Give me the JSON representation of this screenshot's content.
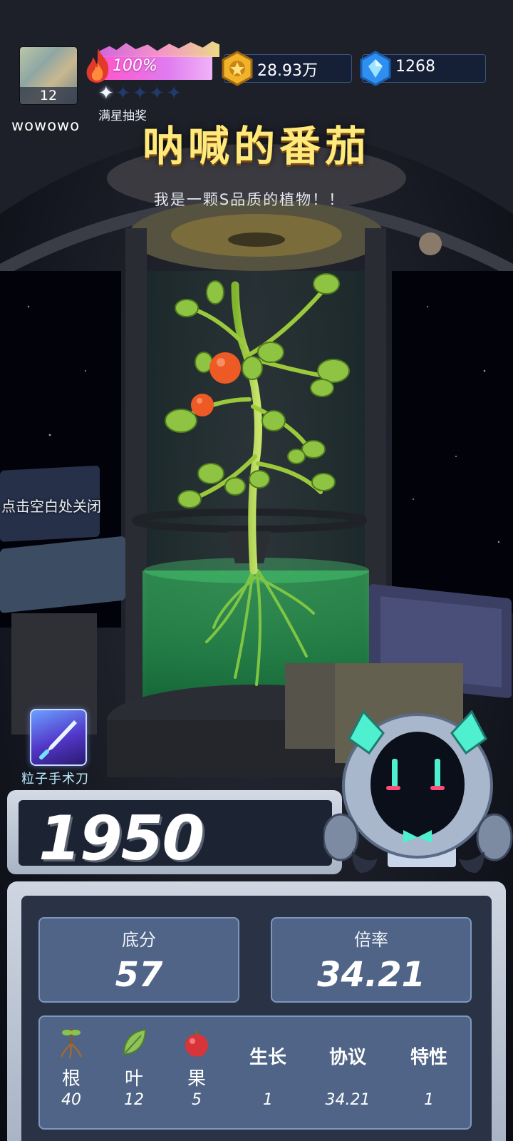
{
  "player": {
    "name": "wowowo",
    "level": "12"
  },
  "energy": {
    "percent_label": "100%"
  },
  "stars": {
    "label": "满星抽奖",
    "filled": 1,
    "total": 5
  },
  "currency": {
    "gold": "28.93万",
    "gems": "1268"
  },
  "plant": {
    "name": "呐喊的番茄",
    "description": "我是一颗S品质的植物！！"
  },
  "hint": {
    "close": "点击空白处关闭"
  },
  "tool": {
    "label": "粒子手术刀"
  },
  "score": {
    "total": "1950"
  },
  "stats": {
    "base": {
      "label": "底分",
      "value": "57"
    },
    "multiplier": {
      "label": "倍率",
      "value": "34.21"
    }
  },
  "attributes": [
    {
      "name": "根",
      "value": "40",
      "icon": "root-icon"
    },
    {
      "name": "叶",
      "value": "12",
      "icon": "leaf-icon"
    },
    {
      "name": "果",
      "value": "5",
      "icon": "fruit-icon"
    },
    {
      "name": "生长",
      "value": "1"
    },
    {
      "name": "协议",
      "value": "34.21"
    },
    {
      "name": "特性",
      "value": "1"
    }
  ],
  "colors": {
    "title": "#ffe97a",
    "panel": "#4f6486",
    "accent_cyan": "#4ef0d0"
  }
}
